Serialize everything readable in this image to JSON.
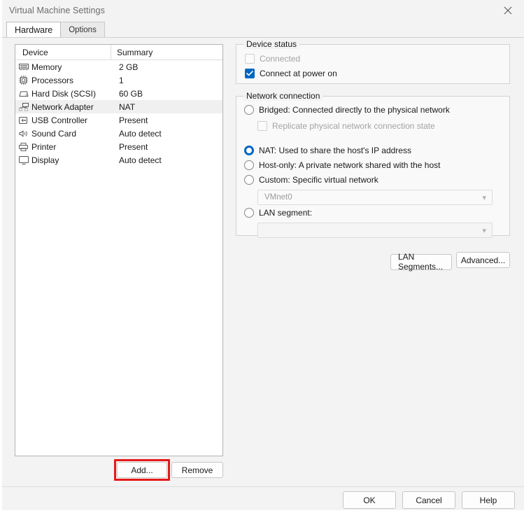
{
  "window": {
    "title": "Virtual Machine Settings",
    "close_icon": "close-icon"
  },
  "tabs": [
    {
      "label": "Hardware",
      "active": true
    },
    {
      "label": "Options",
      "active": false
    }
  ],
  "device_list": {
    "columns": [
      "Device",
      "Summary"
    ],
    "rows": [
      {
        "icon": "memory-icon",
        "device": "Memory",
        "summary": "2 GB",
        "selected": false
      },
      {
        "icon": "processor-icon",
        "device": "Processors",
        "summary": "1",
        "selected": false
      },
      {
        "icon": "harddisk-icon",
        "device": "Hard Disk (SCSI)",
        "summary": "60 GB",
        "selected": false
      },
      {
        "icon": "network-icon",
        "device": "Network Adapter",
        "summary": "NAT",
        "selected": true
      },
      {
        "icon": "usb-icon",
        "device": "USB Controller",
        "summary": "Present",
        "selected": false
      },
      {
        "icon": "sound-icon",
        "device": "Sound Card",
        "summary": "Auto detect",
        "selected": false
      },
      {
        "icon": "printer-icon",
        "device": "Printer",
        "summary": "Present",
        "selected": false
      },
      {
        "icon": "display-icon",
        "device": "Display",
        "summary": "Auto detect",
        "selected": false
      }
    ]
  },
  "device_status": {
    "legend": "Device status",
    "connected": {
      "label": "Connected",
      "checked": false,
      "disabled": true
    },
    "connect_at_power_on": {
      "label": "Connect at power on",
      "checked": true,
      "disabled": false
    }
  },
  "network_connection": {
    "legend": "Network connection",
    "bridged": {
      "label": "Bridged: Connected directly to the physical network",
      "selected": false
    },
    "replicate": {
      "label": "Replicate physical network connection state",
      "checked": false,
      "disabled": true
    },
    "nat": {
      "label": "NAT: Used to share the host's IP address",
      "selected": true
    },
    "host_only": {
      "label": "Host-only: A private network shared with the host",
      "selected": false
    },
    "custom": {
      "label": "Custom: Specific virtual network",
      "selected": false
    },
    "custom_dropdown": {
      "value": "VMnet0",
      "disabled": true
    },
    "lan_segment": {
      "label": "LAN segment:",
      "selected": false
    },
    "lan_dropdown": {
      "value": "",
      "disabled": true
    },
    "lan_segments_button": "LAN Segments...",
    "advanced_button": "Advanced..."
  },
  "device_buttons": {
    "add": "Add...",
    "remove": "Remove"
  },
  "footer_buttons": {
    "ok": "OK",
    "cancel": "Cancel",
    "help": "Help"
  },
  "colors": {
    "accent": "#0067c0",
    "highlight_box": "#e61919",
    "selection": "#f0f0f0",
    "disabled_text": "#a3a3a3"
  }
}
